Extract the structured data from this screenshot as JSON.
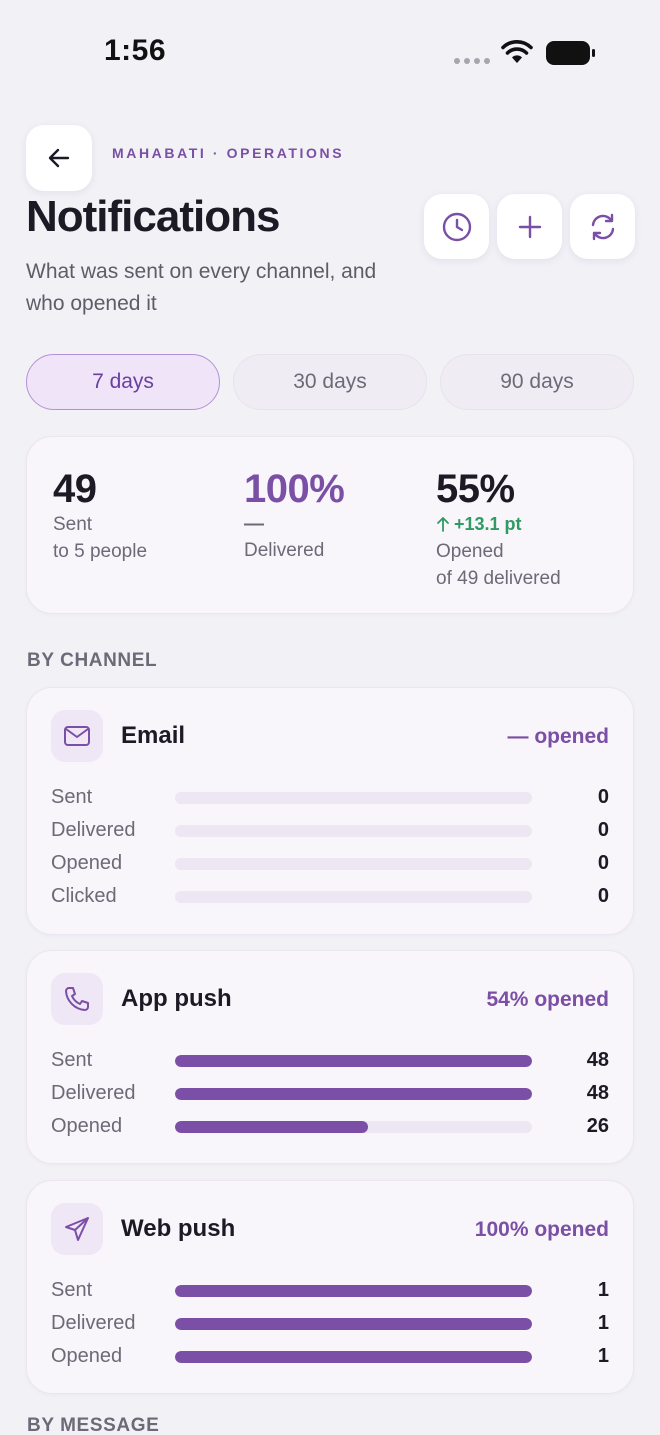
{
  "status_bar": {
    "time": "1:56"
  },
  "header": {
    "breadcrumb": "MAHABATI · OPERATIONS",
    "title": "Notifications",
    "subtitle": "What was sent on every channel, and who opened it"
  },
  "range_tabs": [
    {
      "label": "7 days",
      "active": true
    },
    {
      "label": "30 days",
      "active": false
    },
    {
      "label": "90 days",
      "active": false
    }
  ],
  "summary": {
    "sent": {
      "value": "49",
      "label": "Sent",
      "detail": "to 5 people"
    },
    "delivered": {
      "value": "100%",
      "delta": "—",
      "label": "Delivered"
    },
    "opened": {
      "value": "55%",
      "delta": "+13.1 pt",
      "label": "Opened",
      "detail": "of 49 delivered"
    }
  },
  "sections": {
    "by_channel": "BY CHANNEL",
    "by_message": "BY MESSAGE"
  },
  "channels": [
    {
      "name": "Email",
      "icon": "mail-icon",
      "rate": "— opened",
      "metrics": [
        {
          "label": "Sent",
          "value": "0",
          "fraction": 0
        },
        {
          "label": "Delivered",
          "value": "0",
          "fraction": 0
        },
        {
          "label": "Opened",
          "value": "0",
          "fraction": 0
        },
        {
          "label": "Clicked",
          "value": "0",
          "fraction": 0
        }
      ]
    },
    {
      "name": "App push",
      "icon": "phone-icon",
      "rate": "54% opened",
      "metrics": [
        {
          "label": "Sent",
          "value": "48",
          "fraction": 1
        },
        {
          "label": "Delivered",
          "value": "48",
          "fraction": 1
        },
        {
          "label": "Opened",
          "value": "26",
          "fraction": 0.54
        }
      ]
    },
    {
      "name": "Web push",
      "icon": "send-icon",
      "rate": "100% opened",
      "metrics": [
        {
          "label": "Sent",
          "value": "1",
          "fraction": 1
        },
        {
          "label": "Delivered",
          "value": "1",
          "fraction": 1
        },
        {
          "label": "Opened",
          "value": "1",
          "fraction": 1
        }
      ]
    }
  ],
  "colors": {
    "accent": "#7a4fa5",
    "positive": "#2f9a62",
    "track": "#ece7f2"
  }
}
